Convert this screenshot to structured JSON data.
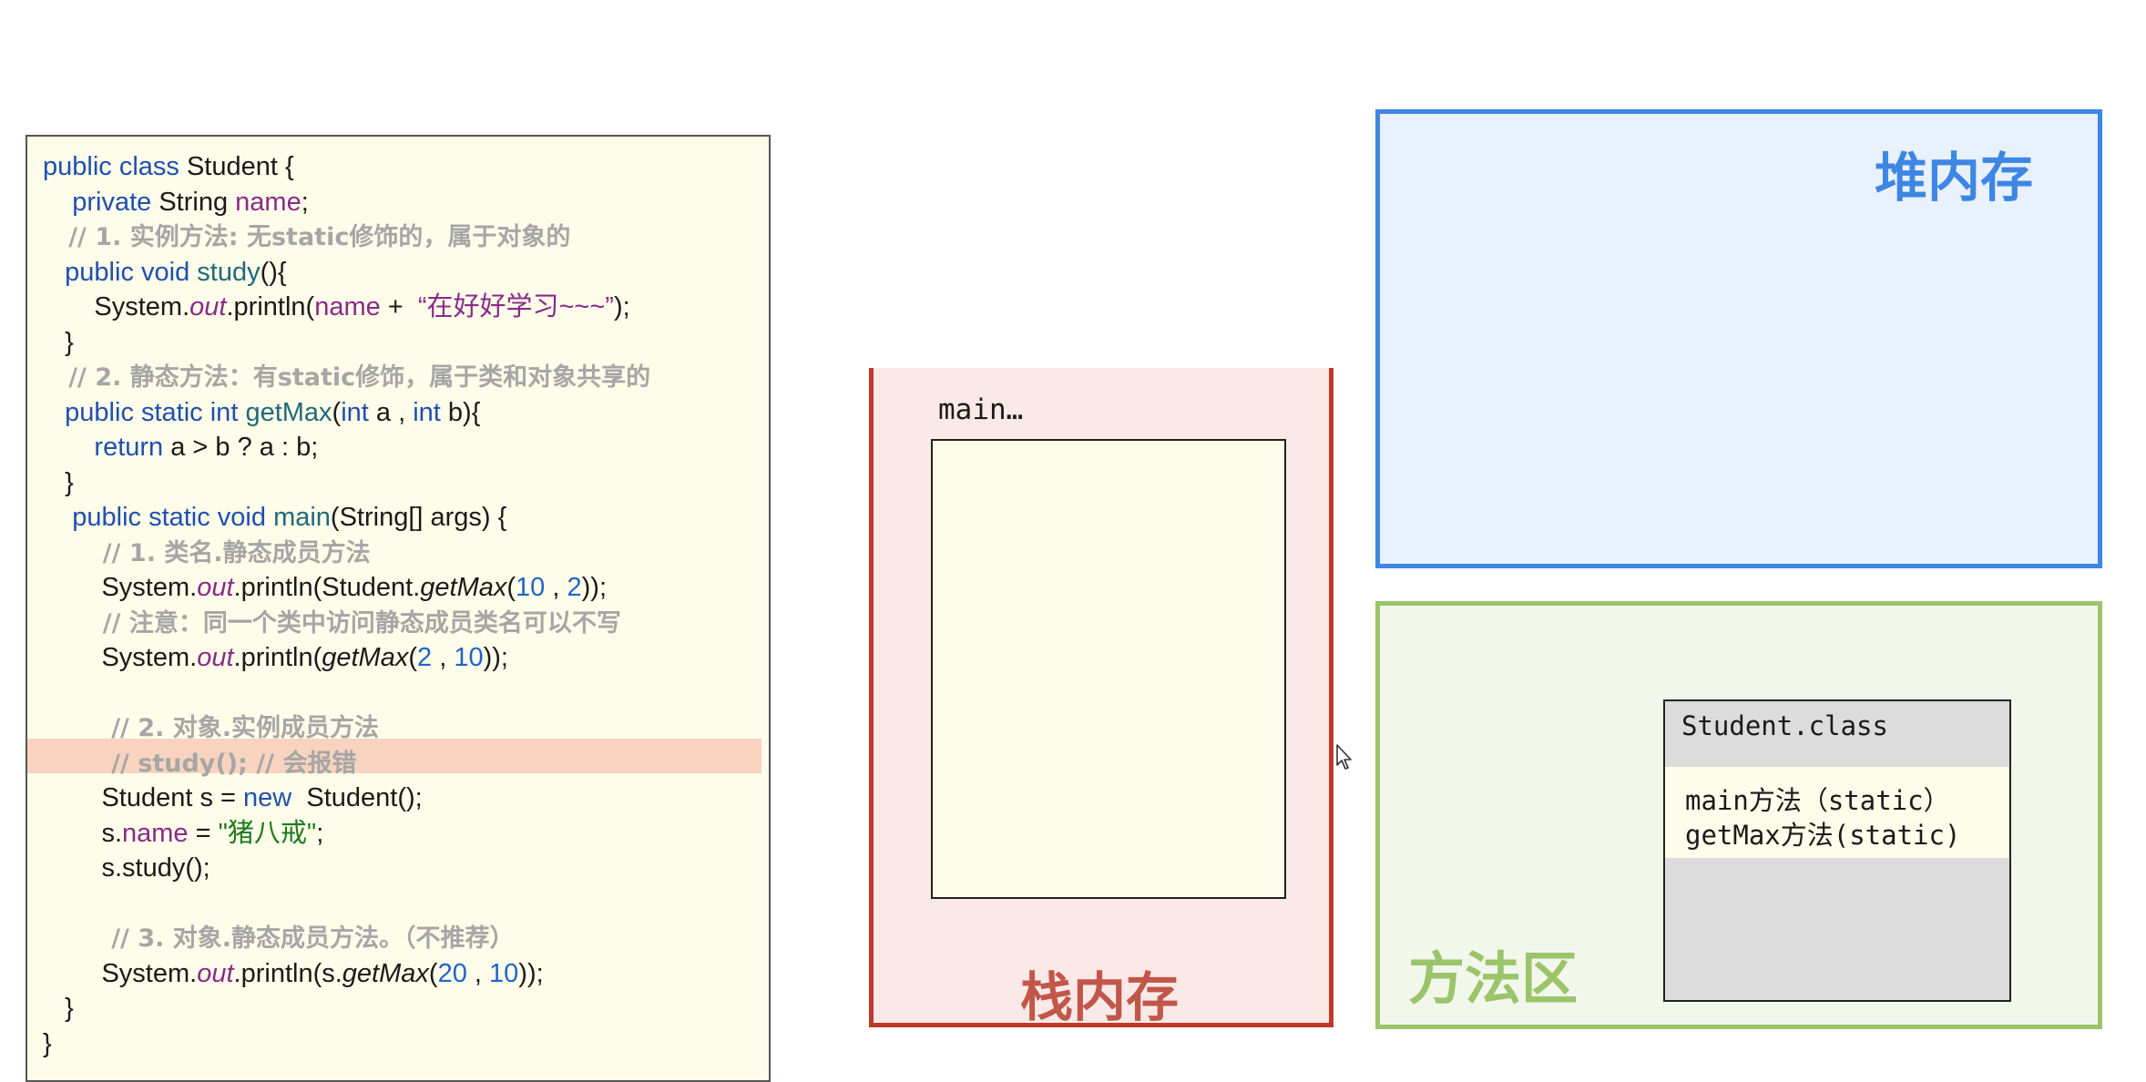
{
  "code": {
    "lines": [
      [
        {
          "t": "public class ",
          "c": "kw"
        },
        {
          "t": "Student {"
        }
      ],
      [
        {
          "t": "    "
        },
        {
          "t": "private ",
          "c": "kw"
        },
        {
          "t": "String "
        },
        {
          "t": "name",
          "c": "var"
        },
        {
          "t": ";"
        }
      ],
      [
        {
          "t": "   // 1. 实例方法: 无static修饰的，属于对象的",
          "c": "cm"
        }
      ],
      [
        {
          "t": "   "
        },
        {
          "t": "public void ",
          "c": "kw"
        },
        {
          "t": "study",
          "c": "fn"
        },
        {
          "t": "(){"
        }
      ],
      [
        {
          "t": "       System."
        },
        {
          "t": "out",
          "c": "out"
        },
        {
          "t": ".println("
        },
        {
          "t": "name",
          "c": "var"
        },
        {
          "t": " +  "
        },
        {
          "t": "“在好好学习~~~”",
          "c": "str"
        },
        {
          "t": ");"
        }
      ],
      [
        {
          "t": "   }"
        }
      ],
      [
        {
          "t": "   // 2. 静态方法：有static修饰，属于类和对象共享的",
          "c": "cm"
        }
      ],
      [
        {
          "t": "   "
        },
        {
          "t": "public static int ",
          "c": "kw"
        },
        {
          "t": "getMax",
          "c": "fn"
        },
        {
          "t": "("
        },
        {
          "t": "int ",
          "c": "kw"
        },
        {
          "t": "a , "
        },
        {
          "t": "int ",
          "c": "kw"
        },
        {
          "t": "b){"
        }
      ],
      [
        {
          "t": "       "
        },
        {
          "t": "return ",
          "c": "kw"
        },
        {
          "t": "a > b ? a : b;"
        }
      ],
      [
        {
          "t": "   }"
        }
      ],
      [
        {
          "t": "    "
        },
        {
          "t": "public static void ",
          "c": "kw"
        },
        {
          "t": "main",
          "c": "fn"
        },
        {
          "t": "(String[] args) {"
        }
      ],
      [
        {
          "t": "       // 1. 类名.静态成员方法",
          "c": "cm"
        }
      ],
      [
        {
          "t": "        System."
        },
        {
          "t": "out",
          "c": "out"
        },
        {
          "t": ".println(Student."
        },
        {
          "t": "getMax",
          "c": "it"
        },
        {
          "t": "("
        },
        {
          "t": "10",
          "c": "num"
        },
        {
          "t": " , "
        },
        {
          "t": "2",
          "c": "num"
        },
        {
          "t": "));"
        }
      ],
      [
        {
          "t": "       // 注意：同一个类中访问静态成员类名可以不写",
          "c": "cm"
        }
      ],
      [
        {
          "t": "        System."
        },
        {
          "t": "out",
          "c": "out"
        },
        {
          "t": ".println("
        },
        {
          "t": "getMax",
          "c": "it"
        },
        {
          "t": "("
        },
        {
          "t": "2",
          "c": "num"
        },
        {
          "t": " , "
        },
        {
          "t": "10",
          "c": "num"
        },
        {
          "t": "));"
        }
      ],
      [],
      [
        {
          "t": "        // 2. 对象.实例成员方法",
          "c": "cm"
        }
      ],
      [
        {
          "t": "        // study(); // 会报错",
          "c": "cm"
        }
      ],
      [
        {
          "t": "        Student s = "
        },
        {
          "t": "new ",
          "c": "kw"
        },
        {
          "t": " Student();"
        }
      ],
      [
        {
          "t": "        s."
        },
        {
          "t": "name",
          "c": "var"
        },
        {
          "t": " = "
        },
        {
          "t": "\"猪八戒\"",
          "c": "str2"
        },
        {
          "t": ";"
        }
      ],
      [
        {
          "t": "        s.study();"
        }
      ],
      [],
      [
        {
          "t": "        // 3. 对象.静态成员方法。（不推荐）",
          "c": "cm"
        }
      ],
      [
        {
          "t": "        System."
        },
        {
          "t": "out",
          "c": "out"
        },
        {
          "t": ".println(s."
        },
        {
          "t": "getMax",
          "c": "it"
        },
        {
          "t": "("
        },
        {
          "t": "20",
          "c": "num"
        },
        {
          "t": " , "
        },
        {
          "t": "10",
          "c": "num"
        },
        {
          "t": "));"
        }
      ],
      [
        {
          "t": "   }"
        }
      ],
      [
        {
          "t": "}"
        }
      ]
    ]
  },
  "stack": {
    "title": "栈内存",
    "frame_label": "main…"
  },
  "heap": {
    "title": "堆内存"
  },
  "method_area": {
    "title": "方法区",
    "class_name": "Student.class",
    "methods": [
      "main方法（static）",
      "getMax方法(static)"
    ]
  },
  "colors": {
    "stack_border": "#c0392b",
    "heap_border": "#3d86e4",
    "method_border": "#9cc46a",
    "code_bg": "#fefdea",
    "highlight_row": "#f8d3c0"
  },
  "icons": {
    "cursor": "mouse-pointer-icon"
  }
}
